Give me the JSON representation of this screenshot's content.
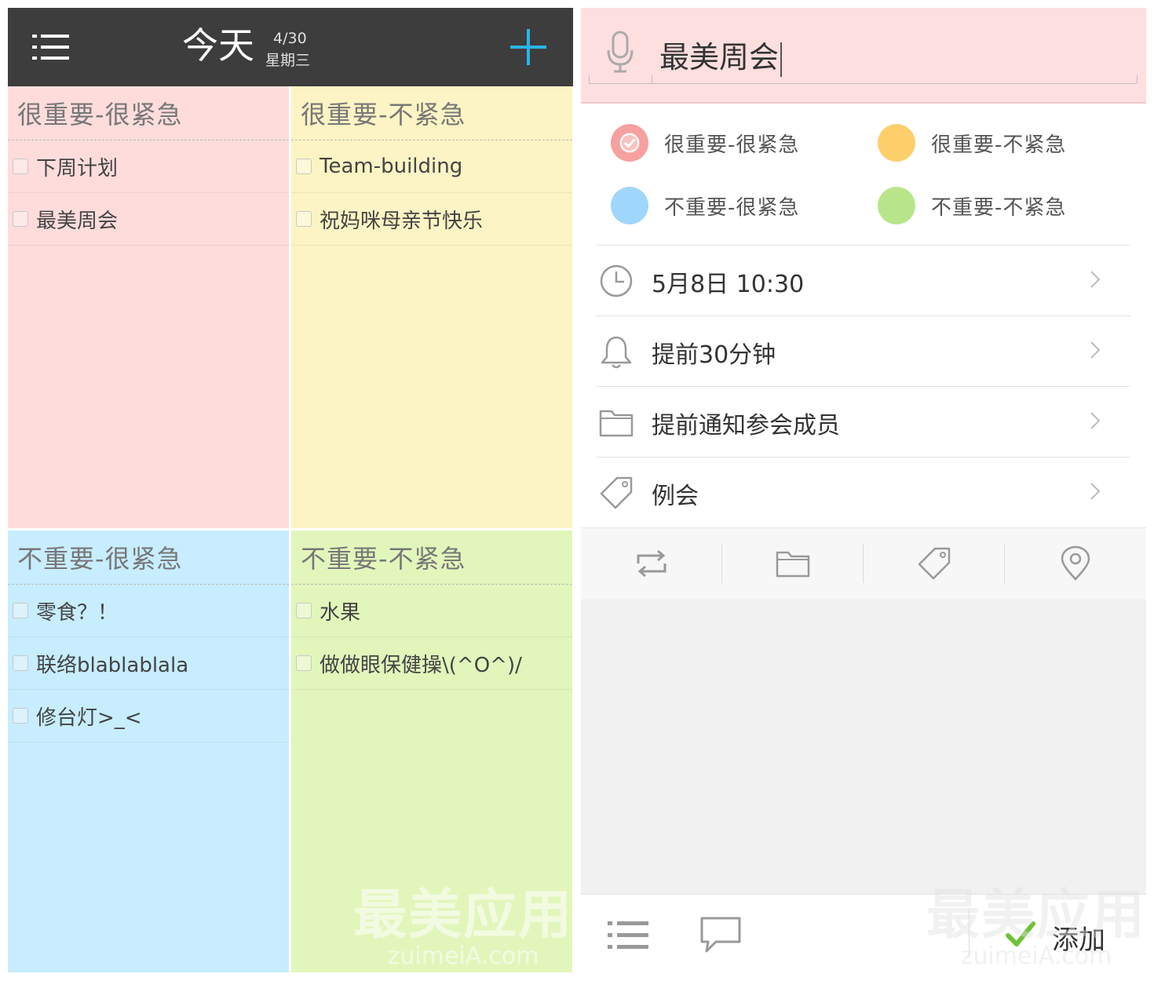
{
  "header": {
    "title": "今天",
    "date": "4/30",
    "weekday": "星期三"
  },
  "quadrants": [
    {
      "title": "很重要-很紧急",
      "color": "#fedcdc",
      "items": [
        "下周计划",
        "最美周会"
      ]
    },
    {
      "title": "很重要-不紧急",
      "color": "#fcf4c4",
      "items": [
        "Team-building",
        "祝妈咪母亲节快乐"
      ]
    },
    {
      "title": "不重要-很紧急",
      "color": "#c7edfe",
      "items": [
        "零食？！",
        "联络blablablala",
        "修台灯>_<"
      ]
    },
    {
      "title": "不重要-不紧急",
      "color": "#e2f6bc",
      "items": [
        "水果",
        "做做眼保健操\\(^O^)/"
      ]
    }
  ],
  "editor": {
    "input_value": "最美周会",
    "priorities": [
      {
        "label": "很重要-很紧急",
        "color": "#f6a0a0",
        "selected": true
      },
      {
        "label": "很重要-不紧急",
        "color": "#fdcf6b",
        "selected": false
      },
      {
        "label": "不重要-很紧急",
        "color": "#9fd6fb",
        "selected": false
      },
      {
        "label": "不重要-不紧急",
        "color": "#b8e58a",
        "selected": false
      }
    ],
    "rows": [
      {
        "icon": "clock-icon",
        "label": "5月8日 10:30"
      },
      {
        "icon": "bell-icon",
        "label": "提前30分钟"
      },
      {
        "icon": "folder-icon",
        "label": "提前通知参会成员"
      },
      {
        "icon": "tag-icon",
        "label": "例会"
      }
    ],
    "toolbar": [
      "repeat-icon",
      "folder-icon",
      "tag-icon",
      "location-pin-icon"
    ],
    "add_label": "添加"
  },
  "watermark": {
    "text": "最美应用",
    "sub": "zuimeiA.com"
  },
  "accent": "#2ab4e8"
}
